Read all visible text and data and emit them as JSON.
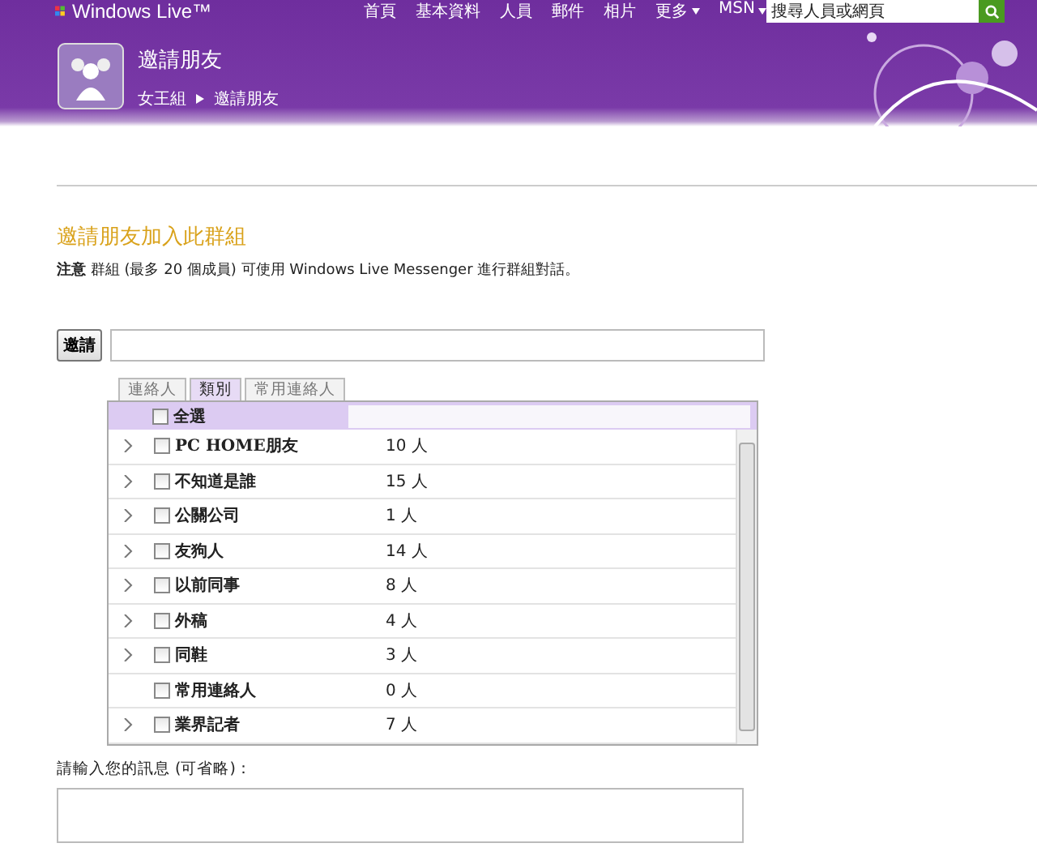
{
  "brand": "Windows Live™",
  "nav": [
    {
      "label": "首頁",
      "menu": false
    },
    {
      "label": "基本資料",
      "menu": false
    },
    {
      "label": "人員",
      "menu": false
    },
    {
      "label": "郵件",
      "menu": false
    },
    {
      "label": "相片",
      "menu": false
    },
    {
      "label": "更多",
      "menu": true
    },
    {
      "label": "MSN",
      "menu": true
    }
  ],
  "search": {
    "placeholder": "搜尋人員或網頁"
  },
  "page_title": "邀請朋友",
  "breadcrumb": [
    "女王組",
    "邀請朋友"
  ],
  "heading": "邀請朋友加入此群組",
  "note": "**注意** 群組 (最多 20 個成員) 可使用 Windows Live Messenger 進行群組對話。",
  "invite_button": "邀請",
  "tabs": [
    {
      "label": "連絡人",
      "selected": false
    },
    {
      "label": "類別",
      "selected": true
    },
    {
      "label": "常用連絡人",
      "selected": false
    }
  ],
  "select_all": {
    "label": "全選",
    "checked": false
  },
  "categories": [
    {
      "name": "PC HOME朋友",
      "count": "10 人",
      "expandable": true,
      "checked": false
    },
    {
      "name": "不知道是誰",
      "count": "15 人",
      "expandable": true,
      "checked": false
    },
    {
      "name": "公關公司",
      "count": "1 人",
      "expandable": true,
      "checked": false
    },
    {
      "name": "友狗人",
      "count": "14 人",
      "expandable": true,
      "checked": false
    },
    {
      "name": "以前同事",
      "count": "8 人",
      "expandable": true,
      "checked": false
    },
    {
      "name": "外稿",
      "count": "4 人",
      "expandable": true,
      "checked": false
    },
    {
      "name": "同鞋",
      "count": "3 人",
      "expandable": true,
      "checked": false
    },
    {
      "name": "常用連絡人",
      "count": "0 人",
      "expandable": false,
      "checked": false
    },
    {
      "name": "業界記者",
      "count": "7 人",
      "expandable": true,
      "checked": false
    }
  ],
  "message_label": "請輸入您的訊息 (可省略)："
}
